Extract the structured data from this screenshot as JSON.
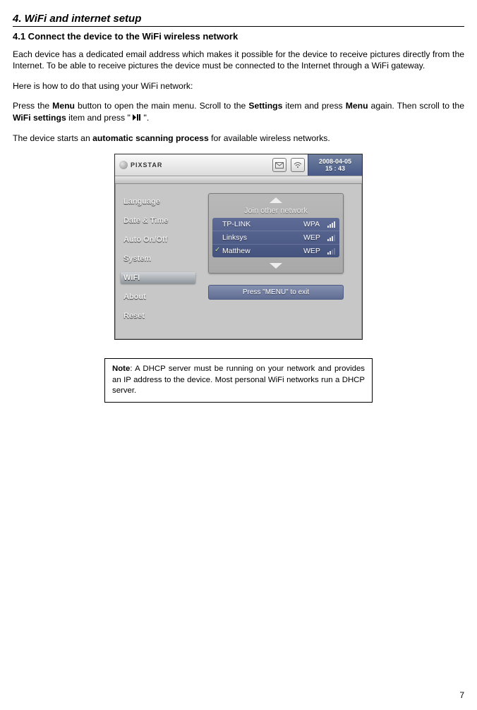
{
  "heading": "4. WiFi and internet setup",
  "subheading": "4.1 Connect the device to the WiFi wireless network",
  "para1": "Each device has a dedicated email address which makes it possible for the device to receive pictures directly from the Internet. To be able to receive pictures the device must be connected to the Internet through a WiFi gateway.",
  "para2": "Here is how to do that using your WiFi network:",
  "para3a": "Press the ",
  "para3b": "Menu",
  "para3c": " button to open the main menu. Scroll to the ",
  "para3d": "Settings",
  "para3e": " item and press ",
  "para3f": "Menu",
  "para3g": " again. Then scroll to the ",
  "para3h": "WiFi settings",
  "para3i": " item and press \" ",
  "para3j": " \".",
  "para4a": "The device starts an ",
  "para4b": "automatic scanning process",
  "para4c": " for available wireless networks.",
  "screenshot": {
    "logo": "PIXSTAR",
    "date_line1": "2008-04-05",
    "date_line2": "15 : 43",
    "sidebar": {
      "items": [
        {
          "label": "Language"
        },
        {
          "label": "Date & Time"
        },
        {
          "label": "Auto On/Off"
        },
        {
          "label": "System"
        },
        {
          "label": "WIFI",
          "active": true
        },
        {
          "label": "About"
        },
        {
          "label": "Reset"
        }
      ]
    },
    "panel": {
      "join_label": "Join  other network",
      "networks": [
        {
          "name": "TP-LINK",
          "security": "WPA",
          "signal": 4,
          "selected": false
        },
        {
          "name": "Linksys",
          "security": "WEP",
          "signal": 3,
          "selected": false
        },
        {
          "name": "Matthew",
          "security": "WEP",
          "signal": 2,
          "selected": true
        }
      ],
      "exit_label": "Press \"MENU\" to exit"
    }
  },
  "note_bold": "Note",
  "note_rest": ": A DHCP server must be running on your network and provides an IP address to the device. Most personal WiFi networks run a DHCP server.",
  "page_number": "7"
}
